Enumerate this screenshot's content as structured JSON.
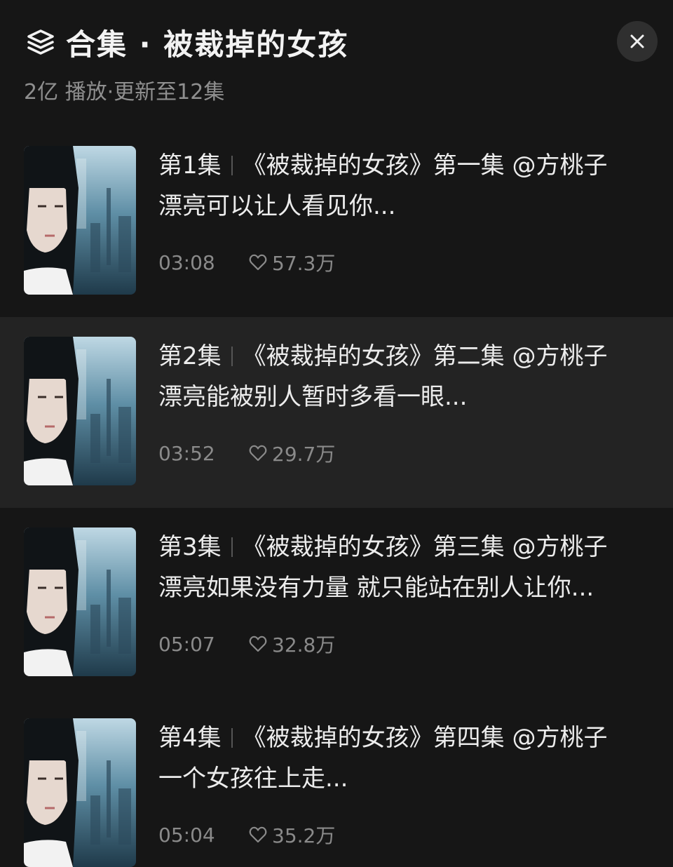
{
  "header": {
    "icon": "layers-stack-icon",
    "title": "合集 · 被裁掉的女孩",
    "subtitle": "2亿 播放·更新至12集",
    "close_icon": "close-icon"
  },
  "episodes": [
    {
      "number": "第1集",
      "title": "《被裁掉的女孩》第一集 @方桃子",
      "desc": "漂亮可以让人看见你...",
      "duration": "03:08",
      "likes": "57.3万",
      "active": false
    },
    {
      "number": "第2集",
      "title": "《被裁掉的女孩》第二集 @方桃子",
      "desc": "漂亮能被别人暂时多看一眼...",
      "duration": "03:52",
      "likes": "29.7万",
      "active": true
    },
    {
      "number": "第3集",
      "title": "《被裁掉的女孩》第三集 @方桃子",
      "desc": "漂亮如果没有力量  就只能站在别人让你...",
      "duration": "05:07",
      "likes": "32.8万",
      "active": false
    },
    {
      "number": "第4集",
      "title": "《被裁掉的女孩》第四集 @方桃子",
      "desc": "一个女孩往上走...",
      "duration": "05:04",
      "likes": "35.2万",
      "active": false
    }
  ],
  "colors": {
    "background": "#161616",
    "active_row": "#232323",
    "text_primary": "#ececec",
    "text_secondary": "#8a8a8a"
  }
}
